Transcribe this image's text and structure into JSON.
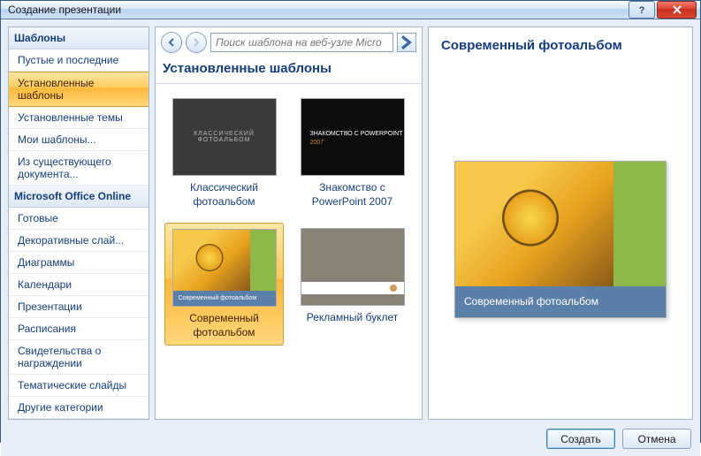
{
  "window": {
    "title": "Создание презентации"
  },
  "sidebar": {
    "header1": "Шаблоны",
    "items1": [
      {
        "label": "Пустые и последние"
      },
      {
        "label": "Установленные шаблоны",
        "active": true
      },
      {
        "label": "Установленные темы"
      },
      {
        "label": "Мои шаблоны..."
      },
      {
        "label": "Из существующего документа..."
      }
    ],
    "header2": "Microsoft Office Online",
    "items2": [
      {
        "label": "Готовые"
      },
      {
        "label": "Декоративные слай..."
      },
      {
        "label": "Диаграммы"
      },
      {
        "label": "Календари"
      },
      {
        "label": "Презентации"
      },
      {
        "label": "Расписания"
      },
      {
        "label": "Свидетельства о награждении"
      },
      {
        "label": "Тематические слайды"
      },
      {
        "label": "Другие категории"
      }
    ]
  },
  "center": {
    "search_placeholder": "Поиск шаблона на веб-узле Micro",
    "title": "Установленные шаблоны",
    "templates": [
      {
        "label": "Классический фотоальбом",
        "thumb_caption": "КЛАССИЧЕСКИЙ ФОТОАЛЬБОМ"
      },
      {
        "label": "Знакомство с PowerPoint 2007",
        "thumb_line1": "ЗНАКОМСТВО С POWERPOINT",
        "thumb_line2": "2007"
      },
      {
        "label": "Современный фотоальбом",
        "selected": true,
        "thumb_caption": "Современный фотоальбом"
      },
      {
        "label": "Рекламный буклет"
      }
    ]
  },
  "preview": {
    "title": "Современный фотоальбом",
    "caption": "Современный фотоальбом"
  },
  "buttons": {
    "create": "Создать",
    "cancel": "Отмена"
  }
}
